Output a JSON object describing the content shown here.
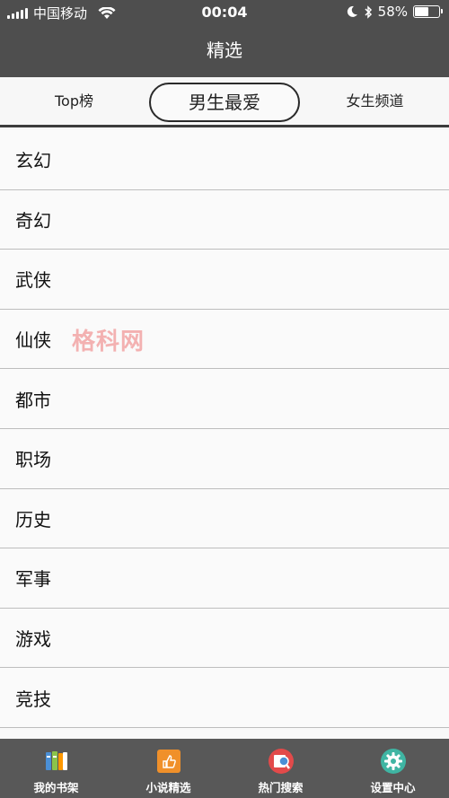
{
  "status_bar": {
    "carrier": "中国移动",
    "time": "00:04",
    "battery_percent": "58%",
    "battery_level": 0.58
  },
  "nav": {
    "title": "精选"
  },
  "tabs": {
    "top": "Top榜",
    "male": "男生最爱",
    "female": "女生频道",
    "selected": "男生最爱"
  },
  "categories": [
    "玄幻",
    "奇幻",
    "武侠",
    "仙侠",
    "都市",
    "职场",
    "历史",
    "军事",
    "游戏",
    "竞技"
  ],
  "watermark": "格科网",
  "tabbar": {
    "items": [
      {
        "label": "我的书架",
        "icon": "bookshelf-icon"
      },
      {
        "label": "小说精选",
        "icon": "thumbs-up-icon"
      },
      {
        "label": "热门搜索",
        "icon": "search-icon"
      },
      {
        "label": "设置中心",
        "icon": "gear-icon"
      }
    ]
  },
  "colors": {
    "bar": "#4e4e4e",
    "tabbar": "#585858",
    "accent_orange": "#f0902a",
    "search_red": "#e24a4a",
    "settings_teal": "#3fb5a3"
  }
}
